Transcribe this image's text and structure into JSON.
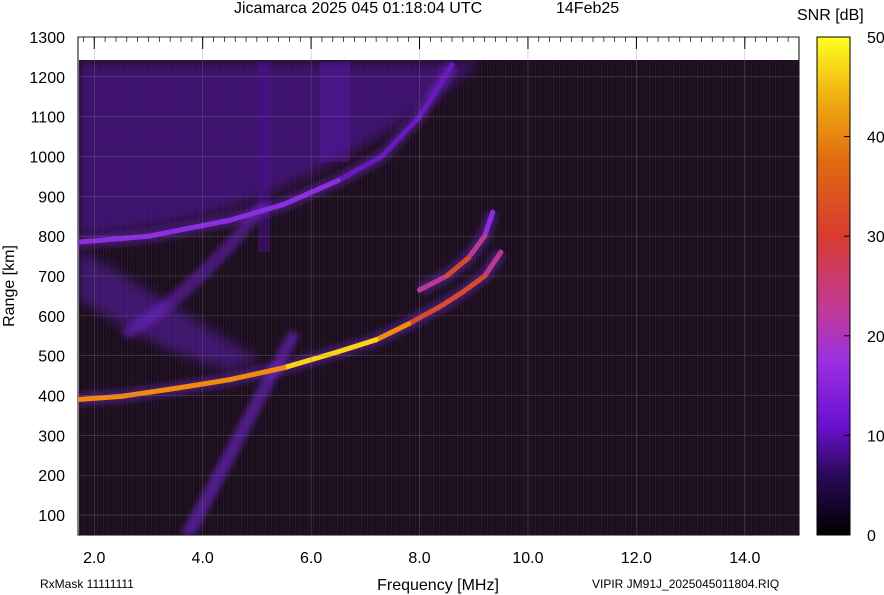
{
  "header": {
    "title": "Jicamarca 2025 045 01:18:04 UTC",
    "date": "14Feb25"
  },
  "footer": {
    "rxmask": "RxMask 11111111",
    "file": "VIPIR  JM91J_2025045011804.RIQ"
  },
  "colors": {
    "background": "#ffffff",
    "plot_background": "#1a0f1a",
    "trace_low": "#7a1fd9",
    "trace_mid": "#c04080",
    "trace_high": "#ffd21a"
  },
  "chart_data": {
    "type": "heatmap",
    "title": "Jicamarca 2025 045 01:18:04 UTC",
    "xlabel": "Frequency [MHz]",
    "ylabel": "Range [km]",
    "xlim": [
      1.7,
      15.0
    ],
    "ylim": [
      50,
      1300
    ],
    "xticks": [
      2.0,
      4.0,
      6.0,
      8.0,
      10.0,
      12.0,
      14.0
    ],
    "xtick_labels": [
      "2.0",
      "4.0",
      "6.0",
      "8.0",
      "10.0",
      "12.0",
      "14.0"
    ],
    "yticks": [
      100,
      200,
      300,
      400,
      500,
      600,
      700,
      800,
      900,
      1000,
      1100,
      1200,
      1300
    ],
    "ytick_labels": [
      "100",
      "200",
      "300",
      "400",
      "500",
      "600",
      "700",
      "800",
      "900",
      "1000",
      "1100",
      "1200",
      "1300"
    ],
    "grid": true,
    "colorbar": {
      "label": "SNR [dB]",
      "range": [
        0,
        50
      ],
      "ticks": [
        0,
        10,
        20,
        30,
        40,
        50
      ],
      "tick_labels": [
        "0",
        "10",
        "20",
        "30",
        "40",
        "50"
      ]
    },
    "series": [
      {
        "name": "",
        "points": [
          {
            "x": 1.7,
            "y": 390,
            "snr": 38
          },
          {
            "x": 2.5,
            "y": 398,
            "snr": 38
          },
          {
            "x": 3.5,
            "y": 418,
            "snr": 36
          },
          {
            "x": 4.5,
            "y": 440,
            "snr": 34
          },
          {
            "x": 5.5,
            "y": 470,
            "snr": 38
          },
          {
            "x": 6.5,
            "y": 510,
            "snr": 42
          },
          {
            "x": 7.2,
            "y": 540,
            "snr": 40
          },
          {
            "x": 7.8,
            "y": 580,
            "snr": 32
          },
          {
            "x": 8.4,
            "y": 625,
            "snr": 30
          },
          {
            "x": 8.8,
            "y": 660,
            "snr": 30
          },
          {
            "x": 9.2,
            "y": 700,
            "snr": 26
          },
          {
            "x": 9.5,
            "y": 760,
            "snr": 20
          }
        ]
      },
      {
        "name": "",
        "points": [
          {
            "x": 8.0,
            "y": 665,
            "snr": 20
          },
          {
            "x": 8.5,
            "y": 700,
            "snr": 26
          },
          {
            "x": 8.9,
            "y": 745,
            "snr": 28
          },
          {
            "x": 9.2,
            "y": 800,
            "snr": 22
          },
          {
            "x": 9.35,
            "y": 860,
            "snr": 16
          }
        ]
      },
      {
        "name": "",
        "points": [
          {
            "x": 1.7,
            "y": 785,
            "snr": 16
          },
          {
            "x": 3.0,
            "y": 800,
            "snr": 16
          },
          {
            "x": 4.5,
            "y": 840,
            "snr": 18
          },
          {
            "x": 5.5,
            "y": 880,
            "snr": 18
          },
          {
            "x": 6.5,
            "y": 940,
            "snr": 14
          },
          {
            "x": 7.3,
            "y": 1000,
            "snr": 12
          },
          {
            "x": 8.0,
            "y": 1100,
            "snr": 10
          },
          {
            "x": 8.6,
            "y": 1230,
            "snr": 10
          }
        ]
      }
    ]
  }
}
